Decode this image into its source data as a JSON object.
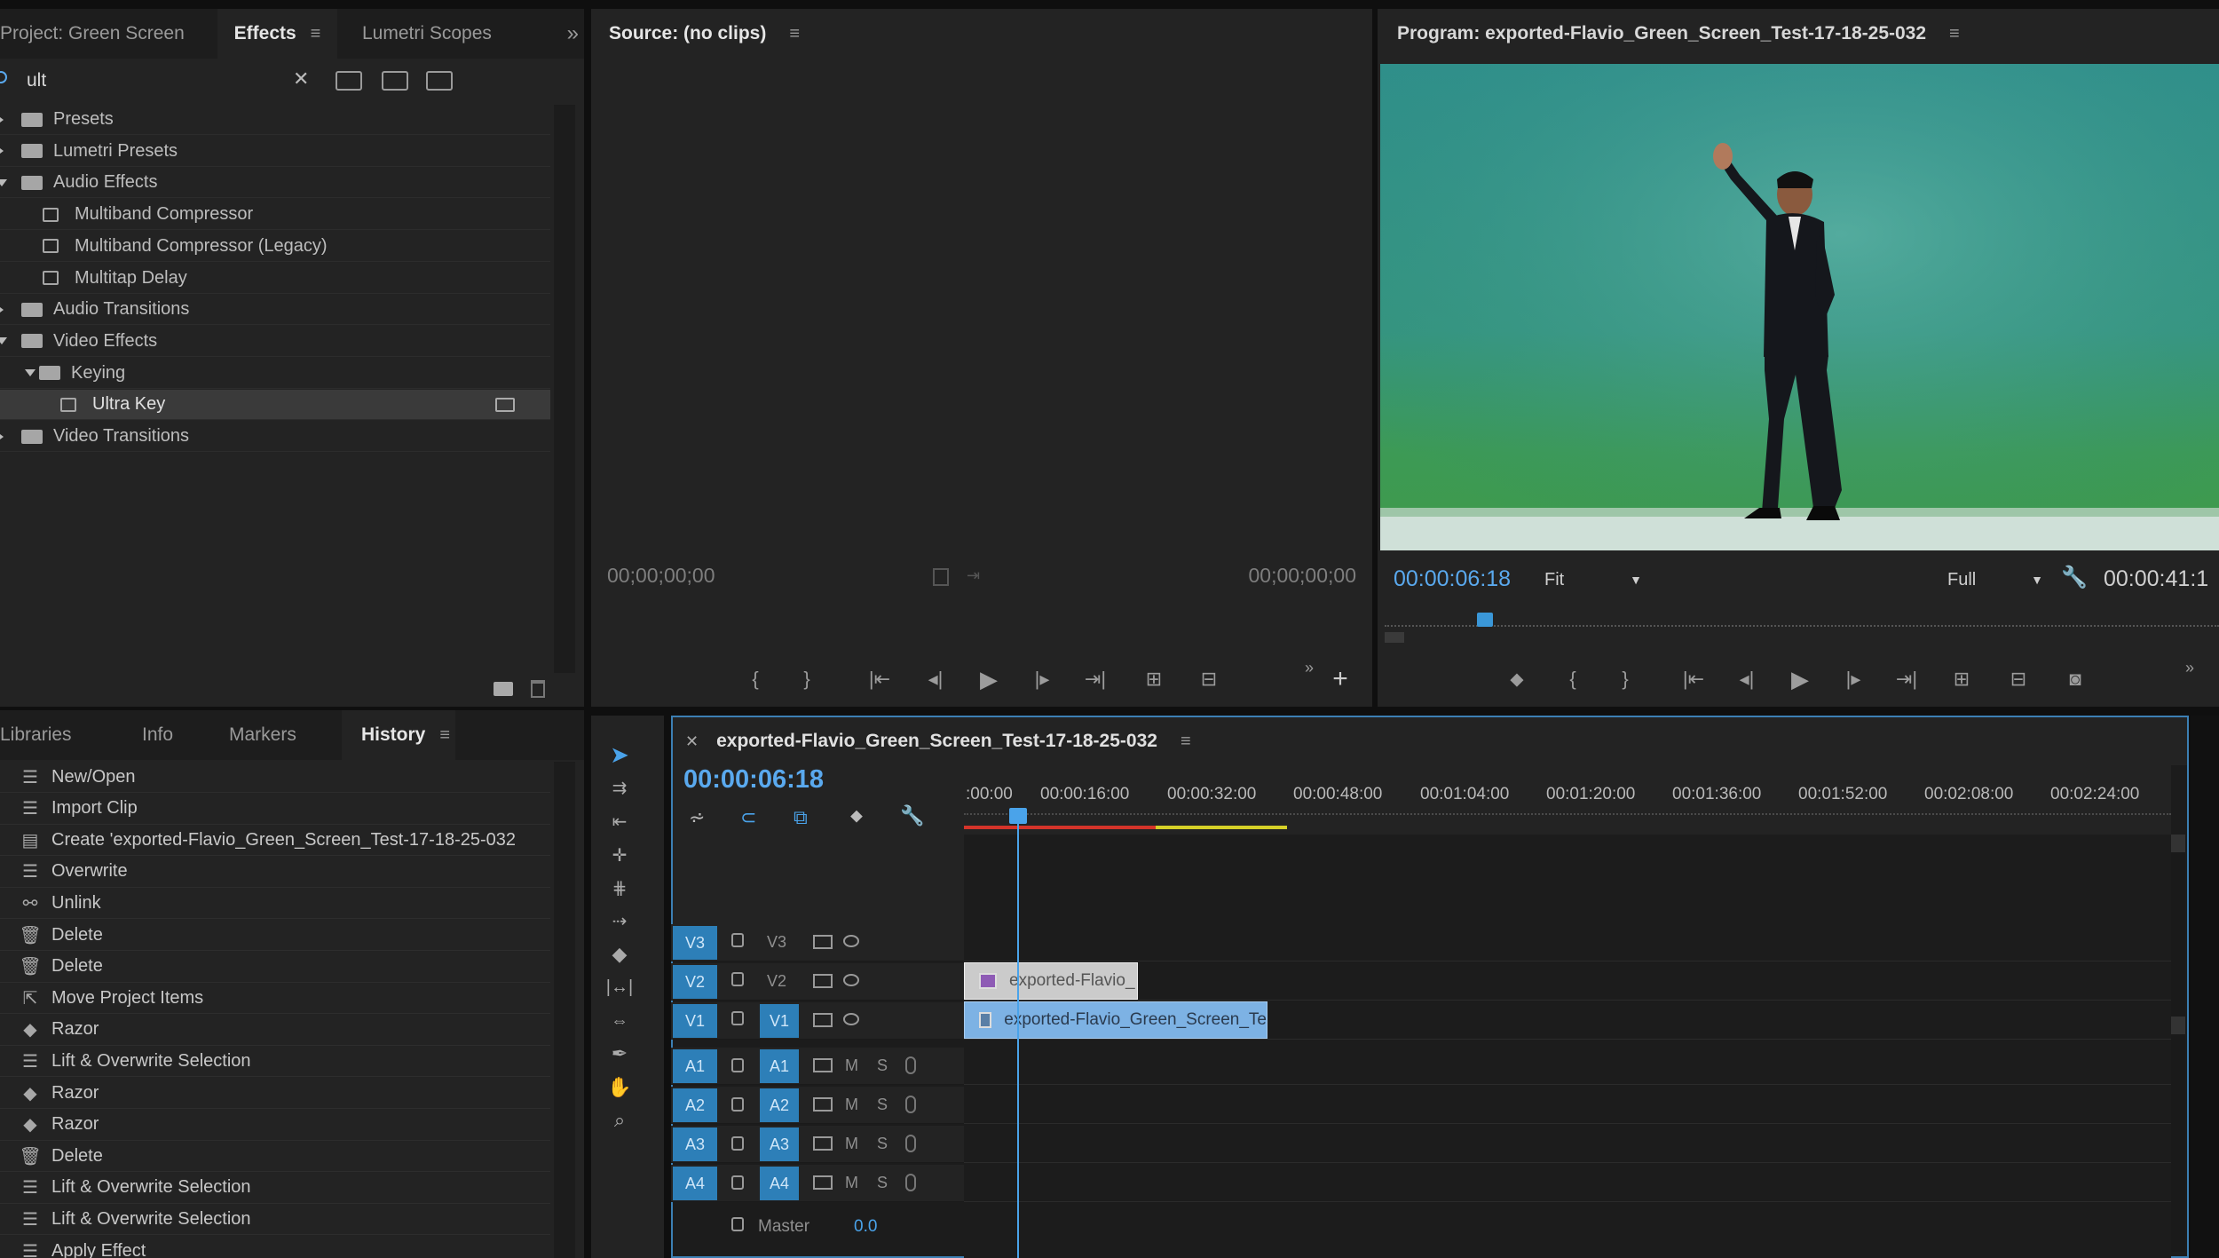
{
  "project_panel": {
    "tabs": [
      "Project: Green Screen",
      "Effects",
      "Lumetri Scopes"
    ],
    "overflow_icon": "double-chevron-right",
    "search_value": "ult",
    "tree": [
      {
        "label": "Presets",
        "expanded": false
      },
      {
        "label": "Lumetri Presets",
        "expanded": false
      },
      {
        "label": "Audio Effects",
        "expanded": true
      },
      {
        "label": "Multiband Compressor"
      },
      {
        "label": "Multiband Compressor (Legacy)"
      },
      {
        "label": "Multitap Delay"
      },
      {
        "label": "Audio Transitions",
        "expanded": false
      },
      {
        "label": "Video Effects",
        "expanded": true
      },
      {
        "label": "Keying",
        "expanded": true
      },
      {
        "label": "Ultra Key",
        "selected": true
      },
      {
        "label": "Video Transitions",
        "expanded": false
      }
    ]
  },
  "history_panel": {
    "tabs": [
      "Libraries",
      "Info",
      "Markers",
      "History"
    ],
    "items": [
      {
        "label": "New/Open",
        "icon": "list-icon"
      },
      {
        "label": "Import Clip",
        "icon": "list-icon"
      },
      {
        "label": "Create 'exported-Flavio_Green_Screen_Test-17-18-25-032",
        "icon": "sequence-icon"
      },
      {
        "label": "Overwrite",
        "icon": "list-icon"
      },
      {
        "label": "Unlink",
        "icon": "unlink-icon"
      },
      {
        "label": "Delete",
        "icon": "trash-icon"
      },
      {
        "label": "Delete",
        "icon": "trash-icon"
      },
      {
        "label": "Move Project Items",
        "icon": "arrow-icon"
      },
      {
        "label": "Razor",
        "icon": "razor-icon"
      },
      {
        "label": "Lift & Overwrite Selection",
        "icon": "list-icon"
      },
      {
        "label": "Razor",
        "icon": "razor-icon"
      },
      {
        "label": "Razor",
        "icon": "razor-icon"
      },
      {
        "label": "Delete",
        "icon": "trash-icon"
      },
      {
        "label": "Lift & Overwrite Selection",
        "icon": "list-icon"
      },
      {
        "label": "Lift & Overwrite Selection",
        "icon": "list-icon"
      },
      {
        "label": "Apply Effect",
        "icon": "list-icon"
      }
    ]
  },
  "source_monitor": {
    "title": "Source: (no clips)",
    "timecode_in": "00;00;00;00",
    "timecode_out": "00;00;00;00"
  },
  "program_monitor": {
    "title": "Program: exported-Flavio_Green_Screen_Test-17-18-25-032",
    "timecode": "00:00:06:18",
    "fit_select": "Fit",
    "quality_select": "Full",
    "duration": "00:00:41:1",
    "playhead_position": 0.12
  },
  "timeline": {
    "sequence_name": "exported-Flavio_Green_Screen_Test-17-18-25-032",
    "timecode": "00:00:06:18",
    "ruler_labels": [
      ":00:00",
      "00:00:16:00",
      "00:00:32:00",
      "00:00:48:00",
      "00:01:04:00",
      "00:01:20:00",
      "00:01:36:00",
      "00:01:52:00",
      "00:02:08:00",
      "00:02:24:00"
    ],
    "video_tracks": [
      {
        "target": "V3",
        "name": "V3",
        "source_active": false
      },
      {
        "target": "V2",
        "name": "V2",
        "source_active": false
      },
      {
        "target": "V1",
        "name": "V1",
        "source_active": true
      }
    ],
    "audio_tracks": [
      {
        "target": "A1",
        "name": "A1",
        "mute": "M",
        "solo": "S"
      },
      {
        "target": "A2",
        "name": "A2",
        "mute": "M",
        "solo": "S"
      },
      {
        "target": "A3",
        "name": "A3",
        "mute": "M",
        "solo": "S"
      },
      {
        "target": "A4",
        "name": "A4",
        "mute": "M",
        "solo": "S"
      }
    ],
    "master": {
      "label": "Master",
      "value": "0.0"
    },
    "clips": [
      {
        "track": "V2",
        "label": "exported-Flavio_",
        "start_sec": 0,
        "end_sec": 21.5
      },
      {
        "track": "V1",
        "label": "exported-Flavio_Green_Screen_Te",
        "start_sec": 0,
        "end_sec": 37.5
      }
    ],
    "playhead_sec": 6.72
  },
  "colors": {
    "accent_blue": "#2d7fb8",
    "timecode_blue": "#5aa9ee",
    "render_red": "#d4342a",
    "render_yellow": "#d6d028"
  }
}
